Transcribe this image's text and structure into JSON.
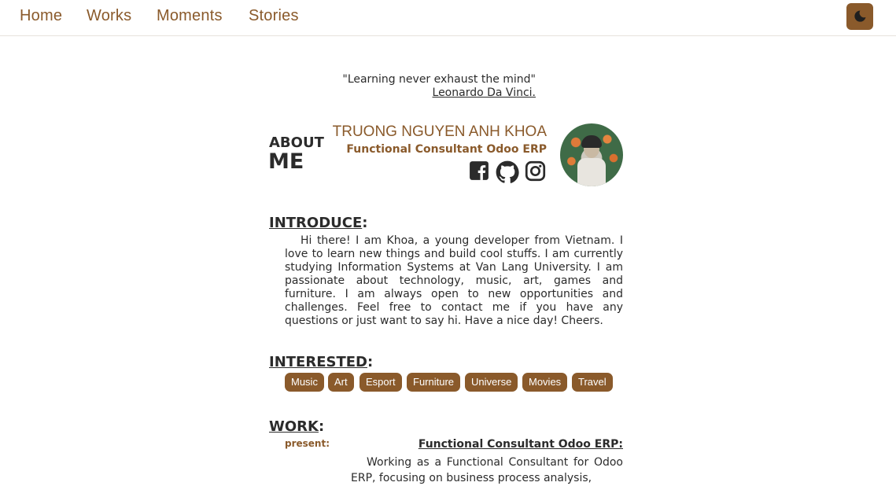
{
  "nav": {
    "items": [
      {
        "label": "Home"
      },
      {
        "label": "Works"
      },
      {
        "label": "Moments"
      },
      {
        "label": "Stories"
      }
    ],
    "theme_toggle_icon": "moon-icon"
  },
  "quote": {
    "text": "\"Learning never exhaust the mind\"",
    "author": "Leonardo Da Vinci."
  },
  "about": {
    "heading_small": "ABOUT",
    "heading_big": "ME",
    "name": "TRUONG NGUYEN ANH KHOA",
    "role": "Functional Consultant Odoo ERP",
    "socials": [
      "facebook-icon",
      "github-icon",
      "instagram-icon"
    ]
  },
  "introduce": {
    "title": "INTRODUCE",
    "colon": ":",
    "text": "Hi there! I am Khoa, a young developer from Vietnam. I love to learn new things and build cool stuffs. I am currently studying Information Systems at Van Lang University. I am passionate about technology, music, art, games and furniture. I am always open to new opportunities and challenges. Feel free to contact me if you have any questions or just want to say hi. Have a nice day! Cheers."
  },
  "interested": {
    "title": "INTERESTED",
    "colon": ":",
    "tags": [
      "Music",
      "Art",
      "Esport",
      "Furniture",
      "Universe",
      "Movies",
      "Travel"
    ]
  },
  "work": {
    "title": "WORK",
    "colon": ":",
    "period": "present:",
    "position": "Functional Consultant Odoo ERP:",
    "description": "Working as a Functional Consultant for Odoo ERP, focusing on business process analysis,"
  },
  "colors": {
    "accent": "#8a5a2b",
    "text": "#2b2b2b",
    "background": "#ffffff"
  }
}
